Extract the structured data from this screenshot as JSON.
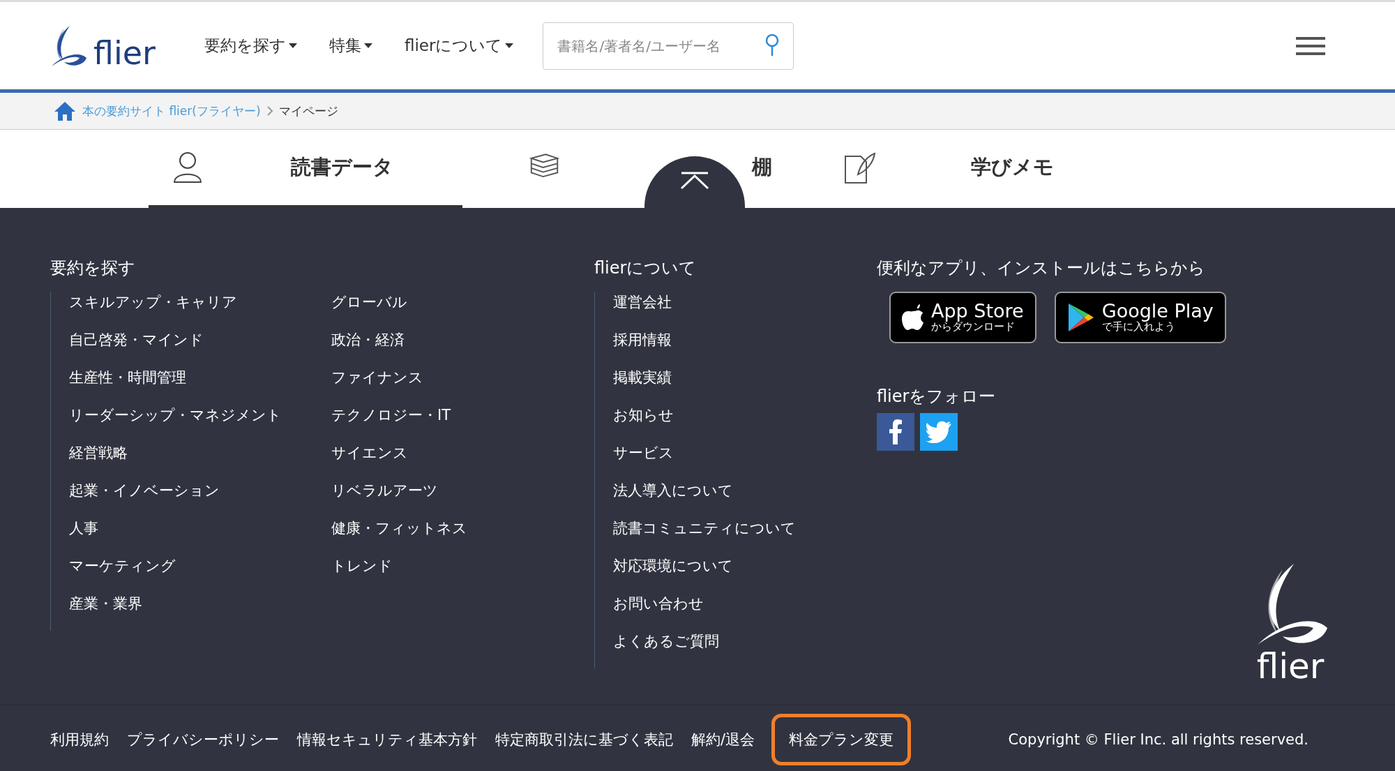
{
  "header": {
    "logo": "flier",
    "nav": [
      {
        "label": "要約を探す"
      },
      {
        "label": "特集"
      },
      {
        "label": "flierについて"
      }
    ],
    "search": {
      "placeholder": "書籍名/著者名/ユーザー名"
    }
  },
  "breadcrumb": [
    {
      "label": "本の要約サイト flier(フライヤー)",
      "kind": "link"
    },
    {
      "label": "マイページ",
      "kind": "current"
    }
  ],
  "tabs": [
    {
      "label": "読書データ",
      "kind": "person",
      "selected": true
    },
    {
      "label": "棚",
      "kind": "books",
      "selected": false
    },
    {
      "label": "学びメモ",
      "kind": "memo",
      "selected": false
    }
  ],
  "footer": {
    "search_heading": "要約を探す",
    "categories_1": [
      "スキルアップ・キャリア",
      "自己啓発・マインド",
      "生産性・時間管理",
      "リーダーシップ・マネジメント",
      "経営戦略",
      "起業・イノベーション",
      "人事",
      "マーケティング",
      "産業・業界"
    ],
    "categories_2": [
      "グローバル",
      "政治・経済",
      "ファイナンス",
      "テクノロジー・IT",
      "サイエンス",
      "リベラルアーツ",
      "健康・フィットネス",
      "トレンド"
    ],
    "about_heading": "flierについて",
    "about_links": [
      "運営会社",
      "採用情報",
      "掲載実績",
      "お知らせ",
      "サービス",
      "法人導入について",
      "読書コミュニティについて",
      "対応環境について",
      "お問い合わせ",
      "よくあるご質問"
    ],
    "app_heading": "便利なアプリ、インストールはこちらから",
    "stores": [
      {
        "kind": "apple",
        "name": "App Store",
        "sub": "からダウンロード"
      },
      {
        "kind": "google",
        "name": "Google Play",
        "sub": "で手に入れよう"
      }
    ],
    "follow_heading": "flierをフォロー",
    "social": [
      {
        "kind": "facebook",
        "color": "#3b5998"
      },
      {
        "kind": "twitter",
        "color": "#1da1f2"
      }
    ],
    "logo": "flier"
  },
  "bottom_bar": {
    "links": [
      {
        "label": "利用規約",
        "highlighted": false
      },
      {
        "label": "プライバシーポリシー",
        "highlighted": false
      },
      {
        "label": "情報セキュリティ基本方針",
        "highlighted": false
      },
      {
        "label": "特定商取引法に基づく表記",
        "highlighted": false
      },
      {
        "label": "解約/退会",
        "highlighted": false
      },
      {
        "label": "料金プラン変更",
        "highlighted": true
      }
    ],
    "copyright": "Copyright © Flier Inc. all rights reserved."
  }
}
